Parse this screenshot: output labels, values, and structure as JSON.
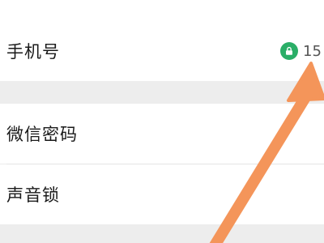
{
  "rows": [
    {
      "label": "手机号",
      "value": "15",
      "value_icon": "lock-icon"
    },
    {
      "label": "微信密码"
    },
    {
      "label": "声音锁"
    }
  ],
  "colors": {
    "lock_badge": "#2aae67",
    "arrow": "#f4955a"
  }
}
